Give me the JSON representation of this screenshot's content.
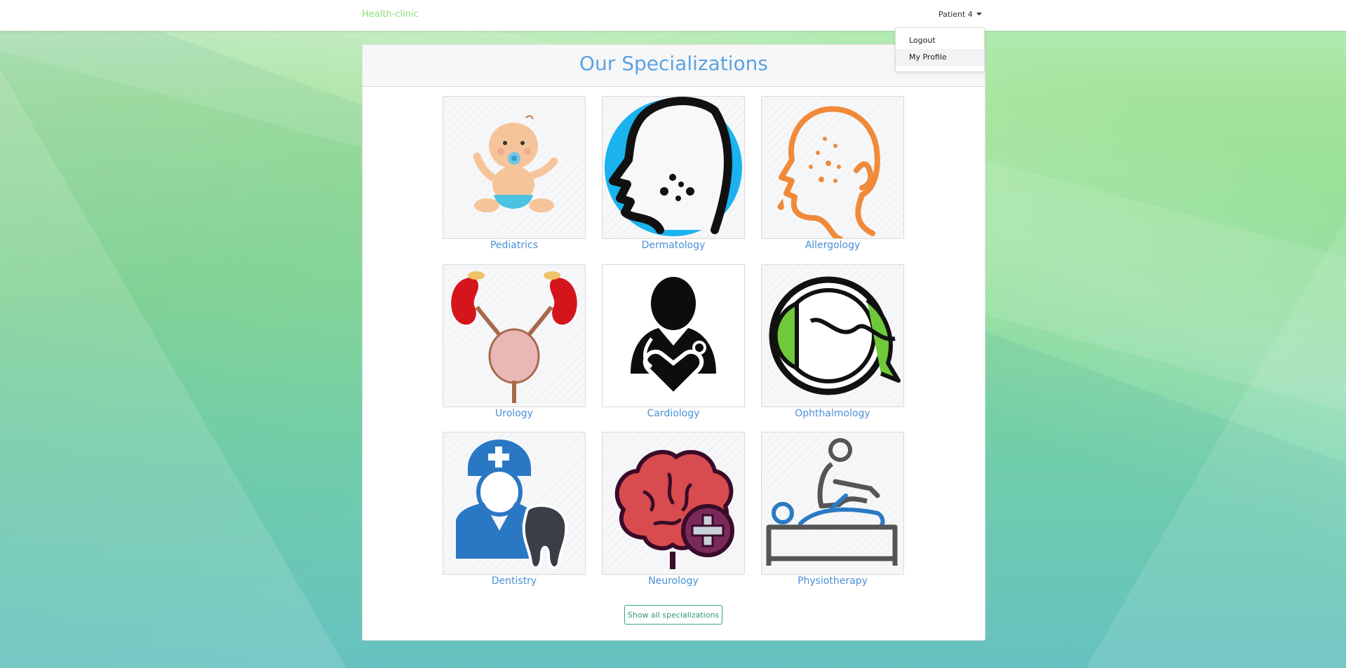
{
  "navbar": {
    "brand": "Health-clinic",
    "user": "Patient 4",
    "menu": [
      "Logout",
      "My Profile"
    ]
  },
  "main": {
    "title": "Our Specializations",
    "specializations": [
      {
        "label": "Pediatrics",
        "icon": "baby-icon"
      },
      {
        "label": "Dermatology",
        "icon": "skin-face-icon"
      },
      {
        "label": "Allergology",
        "icon": "allergy-face-icon"
      },
      {
        "label": "Urology",
        "icon": "kidneys-bladder-icon"
      },
      {
        "label": "Cardiology",
        "icon": "doctor-heart-icon"
      },
      {
        "label": "Ophthalmology",
        "icon": "eye-icon"
      },
      {
        "label": "Dentistry",
        "icon": "dentist-tooth-icon"
      },
      {
        "label": "Neurology",
        "icon": "brain-plus-icon"
      },
      {
        "label": "Physiotherapy",
        "icon": "massage-table-icon"
      }
    ],
    "show_all_label": "Show all specializations"
  },
  "colors": {
    "brand": "#8ee07a",
    "title": "#5aa3e3",
    "link": "#4a8fd6",
    "button": "#2e9a6c"
  }
}
